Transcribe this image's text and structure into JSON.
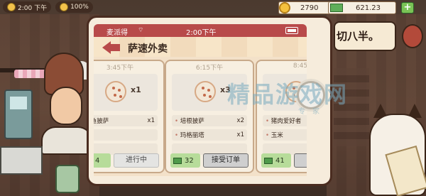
{
  "hud": {
    "date": "2:00 下午",
    "happiness": "100%",
    "coins": "2790",
    "cash": "621.23",
    "plus": "+"
  },
  "background": {
    "speech": "切八半。"
  },
  "phone": {
    "carrier": "麦派得",
    "wifi": "⌔",
    "time": "2:00下午",
    "app_title": "萨速外卖"
  },
  "orders": [
    {
      "time": "3:45下午",
      "qty": "x1",
      "items": [
        {
          "name": "鱼披萨",
          "qty": "x1"
        }
      ],
      "price": "4",
      "action": "进行中"
    },
    {
      "time": "6:15下午",
      "qty": "x3",
      "items": [
        {
          "name": "培根披萨",
          "qty": "x2"
        },
        {
          "name": "玛格丽塔",
          "qty": "x1"
        }
      ],
      "price": "32",
      "action": "接受订单"
    },
    {
      "time": "8:45",
      "qty": "",
      "items": [
        {
          "name": "猪肉爱好者",
          "qty": ""
        },
        {
          "name": "玉米",
          "qty": ""
        }
      ],
      "price": "41",
      "action": "接"
    }
  ],
  "watermark": {
    "main": "精品游戏网",
    "sub": "专家"
  }
}
